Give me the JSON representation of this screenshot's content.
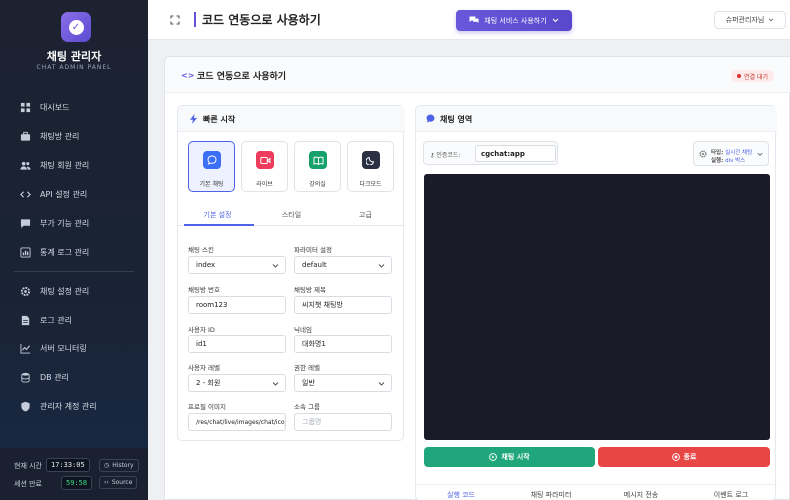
{
  "sidebar": {
    "brand_title": "채팅 관리자",
    "brand_subtitle": "CHAT ADMIN PANEL",
    "items": [
      {
        "label": "대시보드",
        "icon": "dashboard-icon"
      },
      {
        "label": "채팅방 관리",
        "icon": "briefcase-icon"
      },
      {
        "label": "채팅 회원 관리",
        "icon": "users-icon"
      },
      {
        "label": "API 설정 관리",
        "icon": "code-icon"
      },
      {
        "label": "부가 기능 관리",
        "icon": "chat-icon"
      },
      {
        "label": "통계 로그 관리",
        "icon": "chart-icon"
      },
      {
        "label": "채팅 설정 관리",
        "icon": "gear-icon"
      },
      {
        "label": "로그 관리",
        "icon": "file-icon"
      },
      {
        "label": "서버 모니터링",
        "icon": "line-chart-icon"
      },
      {
        "label": "DB 관리",
        "icon": "database-icon"
      },
      {
        "label": "관리자 계정 관리",
        "icon": "shield-icon"
      }
    ],
    "footer": {
      "time_label": "현재 시간",
      "time_value": "17:33:05",
      "history_label": "History",
      "session_label": "세션 만료",
      "session_value": "59:58",
      "source_label": "Source"
    }
  },
  "topbar": {
    "page_title": "코드 연동으로 사용하기",
    "service_button": "채팅 서비스 사용하기",
    "admin_label": "슈퍼관리자님"
  },
  "main": {
    "title": "코드 연동으로 사용하기",
    "connection_status": "연결 대기"
  },
  "quick_start": {
    "title": "빠른 시작",
    "skins": [
      {
        "label": "기본 채팅",
        "icon": "chat-bubble-icon",
        "color": "#3b6ff5",
        "active": true
      },
      {
        "label": "라이브",
        "icon": "video-icon",
        "color": "#ef3b5c",
        "active": false
      },
      {
        "label": "강의실",
        "icon": "book-icon",
        "color": "#16a06a",
        "active": false
      },
      {
        "label": "다크모드",
        "icon": "moon-icon",
        "color": "#2b3042",
        "active": false
      }
    ],
    "tabs": [
      "기본 설정",
      "스타일",
      "고급"
    ],
    "active_tab": "기본 설정",
    "fields": {
      "skin": {
        "label": "채팅 스킨",
        "value": "index"
      },
      "param": {
        "label": "파라미터 설정",
        "value": "default"
      },
      "room_no": {
        "label": "채팅방 번호",
        "value": "room123"
      },
      "room_title": {
        "label": "채팅방 제목",
        "value": "씨지챗 채팅방"
      },
      "user_id": {
        "label": "사용자 ID",
        "value": "id1"
      },
      "nickname": {
        "label": "닉네임",
        "value": "대화명1"
      },
      "user_level": {
        "label": "사용자 레벨",
        "value": "2 - 회원"
      },
      "perm_level": {
        "label": "권한 레벨",
        "value": "일반"
      },
      "profile_image": {
        "label": "프로필 이미지",
        "value": "/res/chat/live/images/chat/ico_p"
      },
      "group": {
        "label": "소속 그룹",
        "placeholder": "그룹명"
      }
    }
  },
  "chat_area": {
    "title": "채팅 영역",
    "auth_label": "인증코드:",
    "auth_value": "cgchat:app",
    "type_label": "타입:",
    "type_value": "실시간 채팅",
    "run_label": "실행:",
    "run_value": "div 박스",
    "start_button": "채팅 시작",
    "end_button": "종료",
    "bottom_tabs": [
      "실행 코드",
      "채팅 파라미터",
      "메시지 전송",
      "이벤트 로그"
    ],
    "active_bottom_tab": "실행 코드"
  },
  "colors": {
    "accent": "#6552d8",
    "primary_blue": "#4d62e6",
    "start_green": "#1fa67a",
    "end_red": "#e84545",
    "sidebar_bg": "#1c2230"
  }
}
